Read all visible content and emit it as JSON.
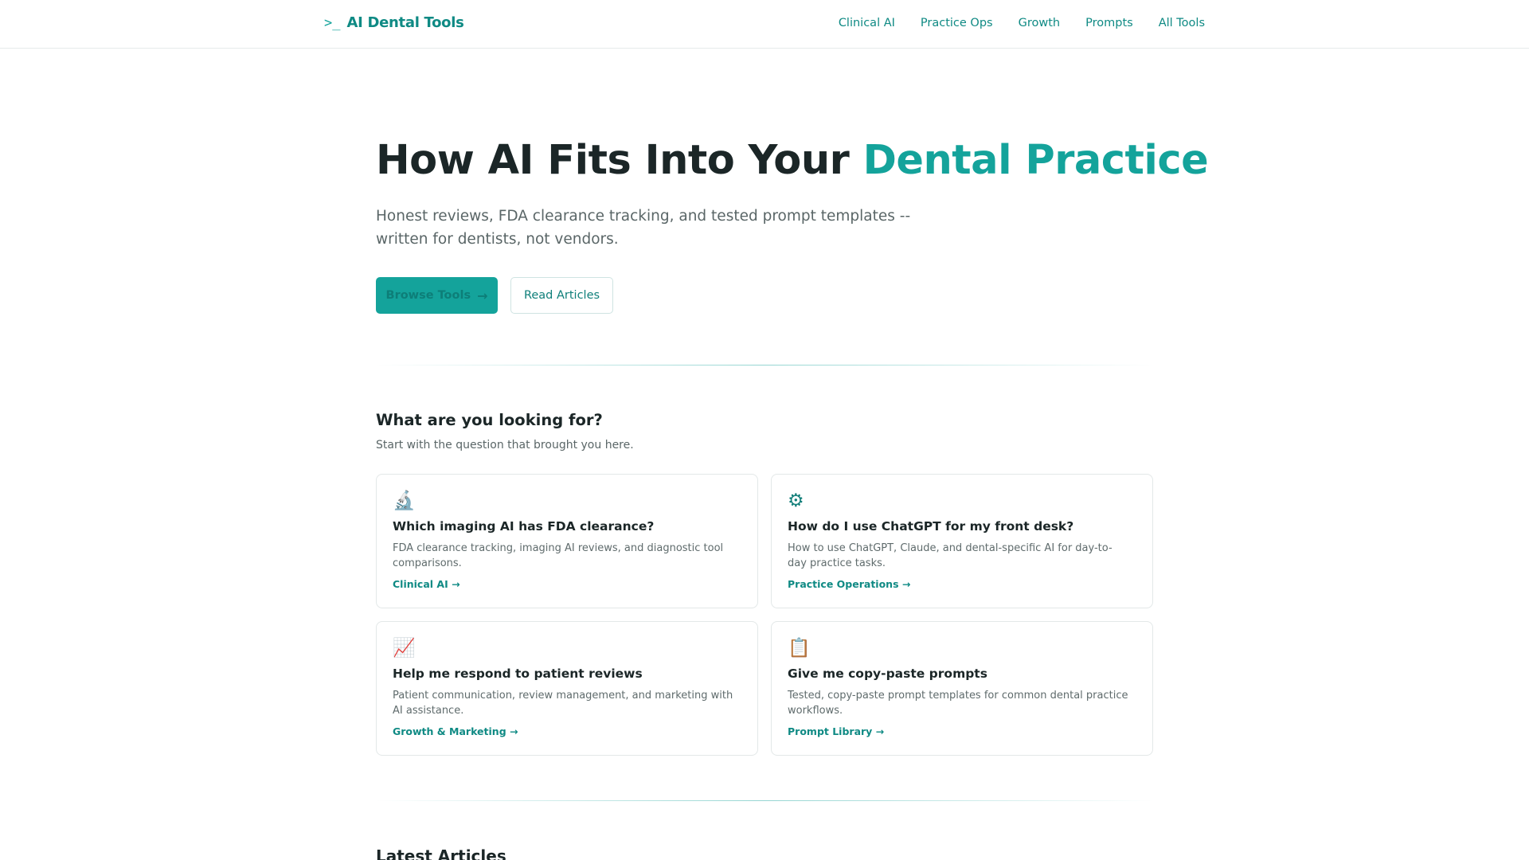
{
  "header": {
    "logo_prompt": ">_",
    "logo_text": "AI Dental Tools",
    "nav": [
      {
        "label": "Clinical AI"
      },
      {
        "label": "Practice Ops"
      },
      {
        "label": "Growth"
      },
      {
        "label": "Prompts"
      },
      {
        "label": "All Tools"
      }
    ]
  },
  "hero": {
    "title_main": "How AI Fits Into Your ",
    "title_accent": "Dental Practice",
    "subtitle": "Honest reviews, FDA clearance tracking, and tested prompt templates -- written for dentists, not vendors.",
    "primary_button": "Browse Tools",
    "primary_button_arrow": "→",
    "secondary_button": "Read Articles"
  },
  "section": {
    "title": "What are you looking for?",
    "subtitle": "Start with the question that brought you here."
  },
  "cards": [
    {
      "icon": "🔬",
      "icon_name": "microscope-icon",
      "title": "Which imaging AI has FDA clearance?",
      "description": "FDA clearance tracking, imaging AI reviews, and diagnostic tool comparisons.",
      "link": "Clinical AI →"
    },
    {
      "icon": "⚙",
      "icon_name": "gear-icon",
      "title": "How do I use ChatGPT for my front desk?",
      "description": "How to use ChatGPT, Claude, and dental-specific AI for day-to-day practice tasks.",
      "link": "Practice Operations →"
    },
    {
      "icon": "📈",
      "icon_name": "chart-increasing-icon",
      "title": "Help me respond to patient reviews",
      "description": "Patient communication, review management, and marketing with AI assistance.",
      "link": "Growth & Marketing →"
    },
    {
      "icon": "📋",
      "icon_name": "clipboard-icon",
      "title": "Give me copy-paste prompts",
      "description": "Tested, copy-paste prompt templates for common dental practice workflows.",
      "link": "Prompt Library →"
    }
  ],
  "latest": {
    "title": "Latest Articles"
  },
  "colors": {
    "accent": "#14a39b",
    "accent_dark": "#0f8a84",
    "heading": "#1b2627",
    "muted": "#5a6667",
    "gear_icon": "#137f7a"
  }
}
